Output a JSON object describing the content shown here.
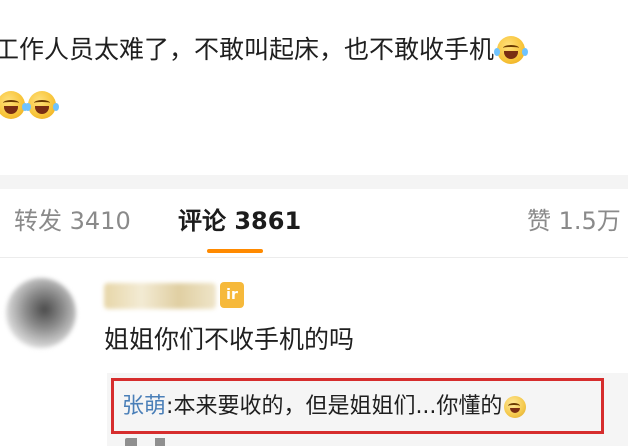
{
  "post": {
    "line1": "工作人员太难了，不敢叫起床，也不敢收手机",
    "emoji_name": "laughing-tears-emoji"
  },
  "tabs": {
    "repost_label": "转发",
    "repost_count": "3410",
    "comment_label": "评论",
    "comment_count": "3861",
    "like_label": "赞",
    "like_count": "1.5万",
    "active": "comment"
  },
  "comment": {
    "text": "姐姐你们不收手机的吗",
    "badge": "ir",
    "reply": {
      "author": "张萌",
      "separator": ":",
      "text": "本来要收的，但是姐姐们...你懂的"
    }
  },
  "colors": {
    "active_tab_underline": "#ff8a00",
    "reply_author": "#4a7fb8",
    "highlight_box": "#d62d2d"
  }
}
